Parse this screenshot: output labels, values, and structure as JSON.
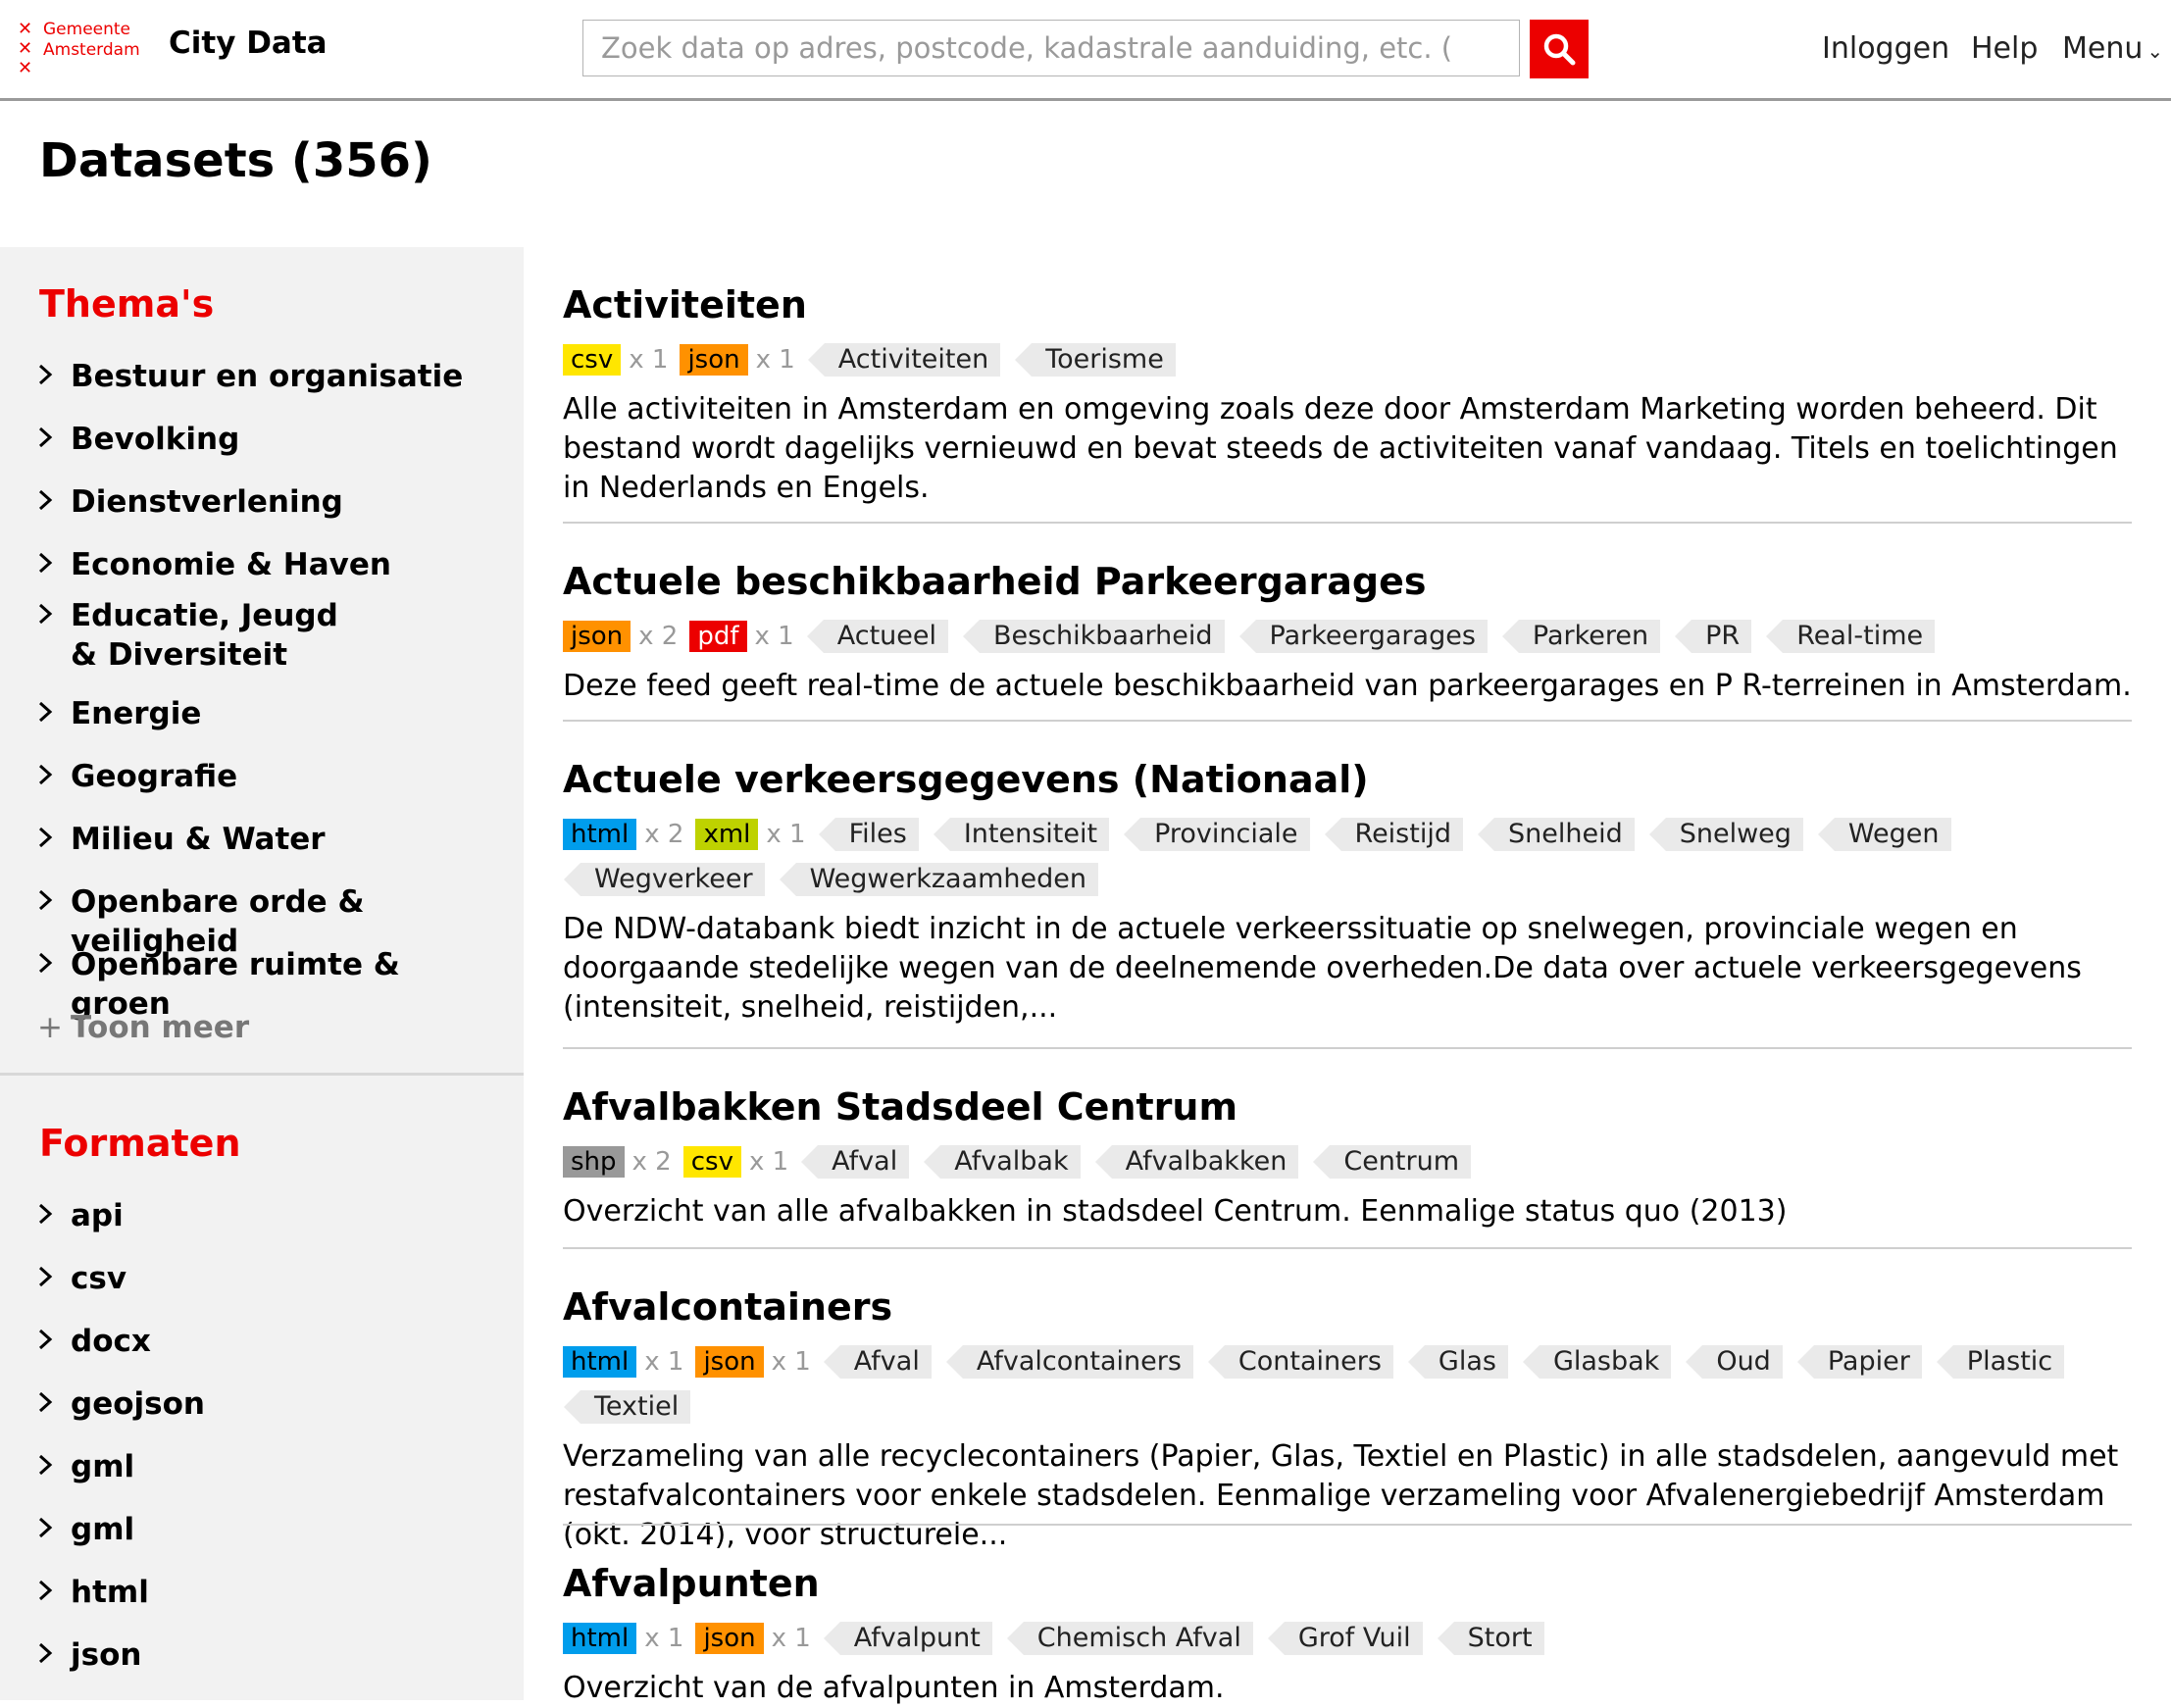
{
  "header": {
    "logo_line1": "Gemeente",
    "logo_line2": "Amsterdam",
    "brand": "City Data",
    "search_placeholder": "Zoek data op adres, postcode, kadastrale aanduiding, etc. (",
    "nav_login": "Inloggen",
    "nav_help": "Help",
    "nav_menu": "Menu"
  },
  "page_title": "Datasets (356)",
  "sidebar": {
    "themes_title": "Thema's",
    "themes": [
      "Bestuur en organisatie",
      "Bevolking",
      "Dienstverlening",
      "Economie & Haven",
      "Educatie, Jeugd & Diversiteit",
      "Energie",
      "Geografie",
      "Milieu & Water",
      "Openbare orde & veiligheid",
      "Openbare ruimte & groen"
    ],
    "show_more": "Toon meer",
    "formats_title": "Formaten",
    "formats": [
      "api",
      "csv",
      "docx",
      "geojson",
      "gml",
      "gml",
      "html",
      "json"
    ]
  },
  "datasets": [
    {
      "title": "Activiteiten",
      "formats": [
        {
          "name": "csv",
          "count": "x 1"
        },
        {
          "name": "json",
          "count": "x 1"
        }
      ],
      "tags": [
        "Activiteiten",
        "Toerisme"
      ],
      "description": "Alle activiteiten in Amsterdam en omgeving zoals deze door Amsterdam Marketing worden beheerd. Dit bestand wordt dagelijks vernieuwd en bevat steeds de activiteiten vanaf vandaag. Titels en toelichtingen in Nederlands en Engels."
    },
    {
      "title": "Actuele beschikbaarheid Parkeergarages",
      "formats": [
        {
          "name": "json",
          "count": "x 2"
        },
        {
          "name": "pdf",
          "count": "x 1"
        }
      ],
      "tags": [
        "Actueel",
        "Beschikbaarheid",
        "Parkeergarages",
        "Parkeren",
        "PR",
        "Real-time"
      ],
      "description": "Deze feed geeft real-time de actuele beschikbaarheid van parkeergarages en P R-terreinen in Amsterdam."
    },
    {
      "title": "Actuele verkeersgegevens (Nationaal)",
      "formats": [
        {
          "name": "html",
          "count": "x 2"
        },
        {
          "name": "xml",
          "count": "x 1"
        }
      ],
      "tags": [
        "Files",
        "Intensiteit",
        "Provinciale",
        "Reistijd",
        "Snelheid",
        "Snelweg",
        "Wegen",
        "Wegverkeer",
        "Wegwerkzaamheden"
      ],
      "description": "De NDW-databank biedt inzicht in de actuele verkeerssituatie op snelwegen, provinciale wegen en doorgaande stedelijke wegen van de deelnemende overheden.De data over actuele verkeersgegevens (intensiteit, snelheid, reistijden,..."
    },
    {
      "title": "Afvalbakken Stadsdeel Centrum",
      "formats": [
        {
          "name": "shp",
          "count": "x 2"
        },
        {
          "name": "csv",
          "count": "x 1"
        }
      ],
      "tags": [
        "Afval",
        "Afvalbak",
        "Afvalbakken",
        "Centrum"
      ],
      "description": "Overzicht van alle afvalbakken in stadsdeel Centrum. Eenmalige status quo (2013)"
    },
    {
      "title": "Afvalcontainers",
      "formats": [
        {
          "name": "html",
          "count": "x 1"
        },
        {
          "name": "json",
          "count": "x 1"
        }
      ],
      "tags": [
        "Afval",
        "Afvalcontainers",
        "Containers",
        "Glas",
        "Glasbak",
        "Oud",
        "Papier",
        "Plastic",
        "Textiel"
      ],
      "description": "Verzameling van alle recyclecontainers (Papier, Glas, Textiel en Plastic) in alle stadsdelen, aangevuld met restafvalcontainers voor enkele stadsdelen. Eenmalige verzameling voor Afvalenergiebedrijf Amsterdam (okt. 2014), voor structurele..."
    },
    {
      "title": "Afvalpunten",
      "formats": [
        {
          "name": "html",
          "count": "x 1"
        },
        {
          "name": "json",
          "count": "x 1"
        }
      ],
      "tags": [
        "Afvalpunt",
        "Chemisch Afval",
        "Grof Vuil",
        "Stort"
      ],
      "description": "Overzicht van de afvalpunten in Amsterdam."
    }
  ]
}
